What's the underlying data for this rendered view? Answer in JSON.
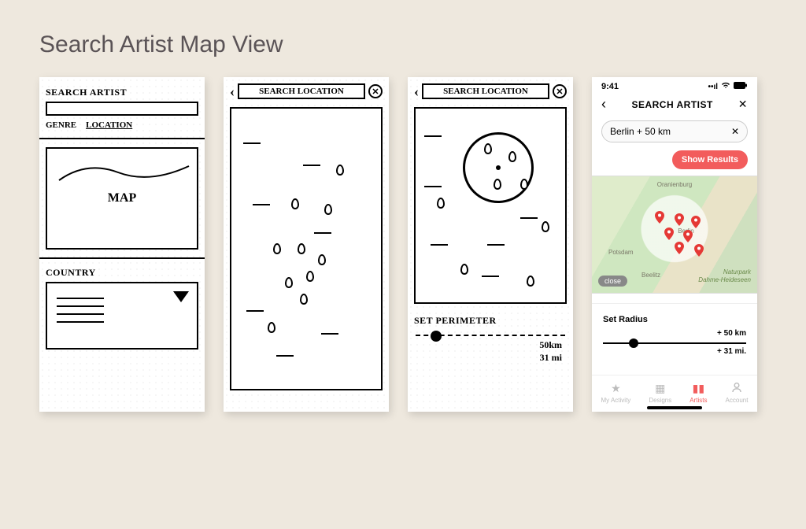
{
  "page": {
    "title": "Search Artist Map View"
  },
  "sketch1": {
    "heading": "SEARCH ARTIST",
    "tab_genre": "GENRE",
    "tab_location": "LOCATION",
    "map_label": "MAP",
    "country_label": "COUNTRY"
  },
  "sketch2": {
    "title": "SEARCH LOCATION"
  },
  "sketch3": {
    "title": "SEARCH LOCATION",
    "perimeter_label": "SET PERIMETER",
    "val_km": "50km",
    "val_mi": "31 mi"
  },
  "hifi": {
    "status_time": "9:41",
    "header_title": "SEARCH ARTIST",
    "search_value": "Berlin + 50 km",
    "show_results": "Show Results",
    "map_city_1": "Oranienburg",
    "map_city_2": "Berlin",
    "map_city_3": "Potsdam",
    "map_city_4": "Naturpark",
    "map_city_5": "Dahme-Heideseen",
    "map_city_6": "Beelitz",
    "close_chip": "close",
    "radius_label": "Set Radius",
    "radius_km": "+ 50 km",
    "radius_mi": "+ 31 mi.",
    "tabs": {
      "activity": "My Activity",
      "designs": "Designs",
      "artists": "Artists",
      "account": "Account"
    }
  }
}
